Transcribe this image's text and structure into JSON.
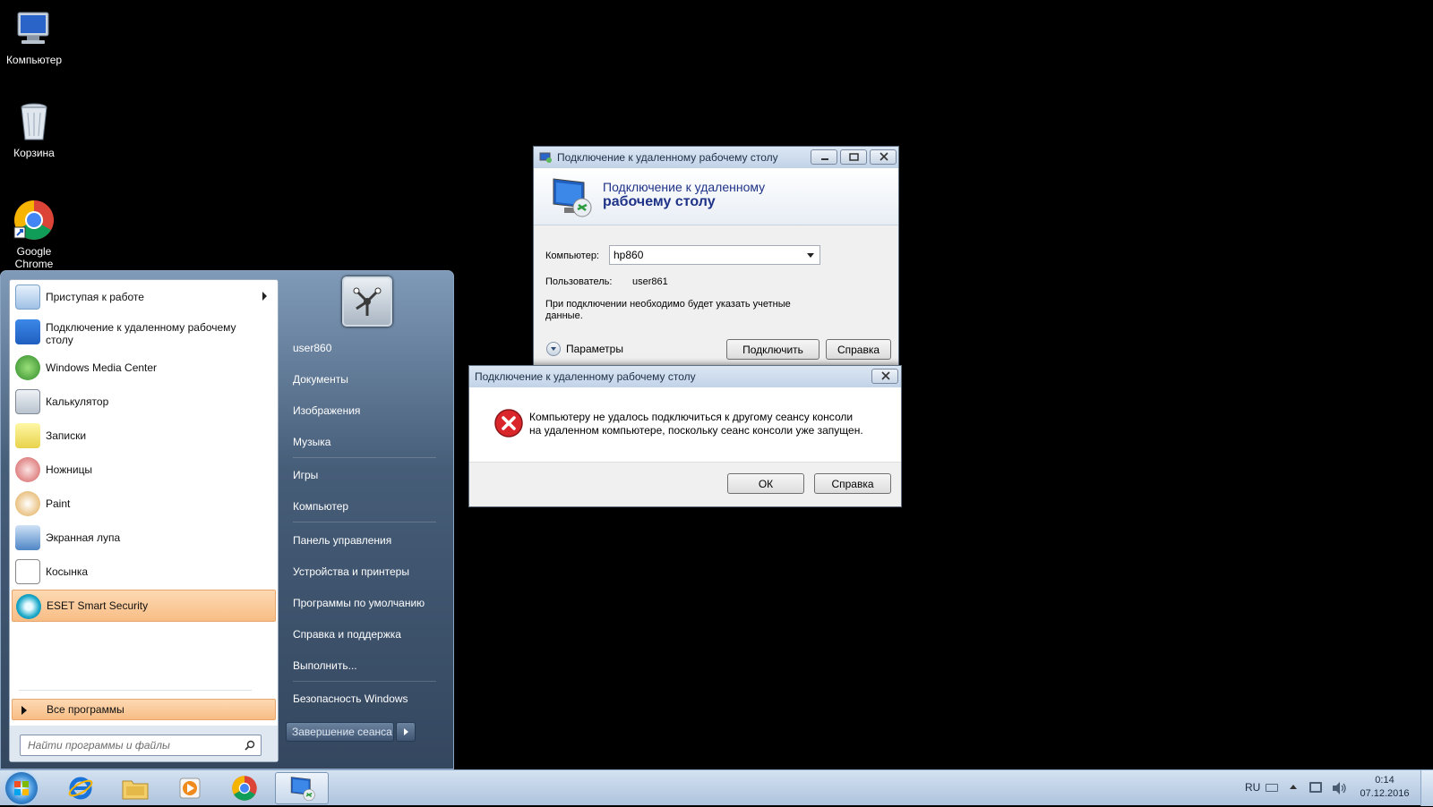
{
  "desktop": {
    "icons": [
      {
        "label": "Компьютер"
      },
      {
        "label": "Корзина"
      },
      {
        "label": "Google Chrome"
      }
    ]
  },
  "start_menu": {
    "programs": [
      {
        "label": "Приступая к работе"
      },
      {
        "label": "Подключение к удаленному рабочему столу"
      },
      {
        "label": "Windows Media Center"
      },
      {
        "label": "Калькулятор"
      },
      {
        "label": "Записки"
      },
      {
        "label": "Ножницы"
      },
      {
        "label": "Paint"
      },
      {
        "label": "Экранная лупа"
      },
      {
        "label": "Косынка"
      },
      {
        "label": "ESET Smart Security"
      }
    ],
    "all_programs": "Все программы",
    "search_placeholder": "Найти программы и файлы",
    "right_items": [
      {
        "label": "user860"
      },
      {
        "label": "Документы"
      },
      {
        "label": "Изображения"
      },
      {
        "label": "Музыка"
      },
      {
        "label": "Игры"
      },
      {
        "label": "Компьютер"
      },
      {
        "label": "Панель управления"
      },
      {
        "label": "Устройства и принтеры"
      },
      {
        "label": "Программы по умолчанию"
      },
      {
        "label": "Справка и поддержка"
      },
      {
        "label": "Выполнить..."
      },
      {
        "label": "Безопасность Windows"
      }
    ],
    "shutdown_label": "Завершение сеанса"
  },
  "rdp_window": {
    "title": "Подключение к удаленному рабочему столу",
    "header_line1": "Подключение к удаленному",
    "header_line2": "рабочему столу",
    "computer_label": "Компьютер:",
    "computer_value": "hp860",
    "user_label": "Пользователь:",
    "user_value": "user861",
    "note": "При подключении необходимо будет указать учетные данные.",
    "params_label": "Параметры",
    "connect_button": "Подключить",
    "help_button": "Справка"
  },
  "error_dialog": {
    "title": "Подключение к удаленному рабочему столу",
    "message_line1": "Компьютеру не удалось подключиться к другому сеансу консоли",
    "message_line2": "на удаленном компьютере, поскольку сеанс консоли уже запущен.",
    "ok_button": "ОК",
    "help_button": "Справка"
  },
  "taskbar": {
    "language": "RU",
    "time": "0:14",
    "date": "07.12.2016"
  },
  "colors": {
    "highlight": "#f8bd85",
    "error_red": "#d9262b",
    "header_blue": "#1e3287"
  }
}
